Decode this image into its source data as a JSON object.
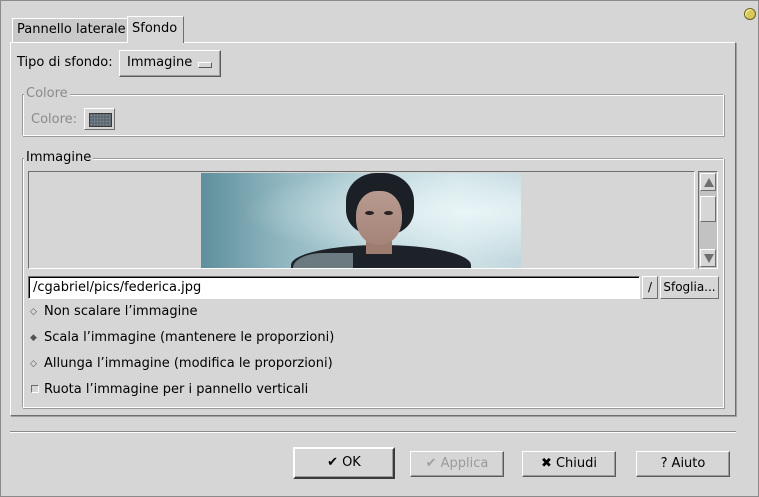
{
  "tabs": [
    {
      "label": "Pannello laterale",
      "active": false
    },
    {
      "label": "Sfondo",
      "active": true
    }
  ],
  "background_type": {
    "label": "Tipo di sfondo:",
    "value": "Immagine"
  },
  "color_frame": {
    "title": "Colore",
    "label": "Colore:",
    "color": "#5c6670",
    "enabled": false
  },
  "image_frame": {
    "title": "Immagine",
    "path": "/cgabriel/pics/federica.jpg",
    "history_label": "/",
    "browse_label": "Sfoglia...",
    "options": [
      {
        "label": "Non scalare l’immagine",
        "selected": false
      },
      {
        "label": "Scala l’immagine (mantenere le proporzioni)",
        "selected": true
      },
      {
        "label": "Allunga l’immagine (modifica le proporzioni)",
        "selected": false
      }
    ],
    "rotate": {
      "label": "Ruota l’immagine per i pannello verticali",
      "checked": false
    }
  },
  "buttons": {
    "ok": "OK",
    "apply": "Applica",
    "close": "Chiudi",
    "help": "Aiuto"
  },
  "colors": {
    "window_bg": "#d6d6d6",
    "photo_bg": "#b9d4da"
  }
}
